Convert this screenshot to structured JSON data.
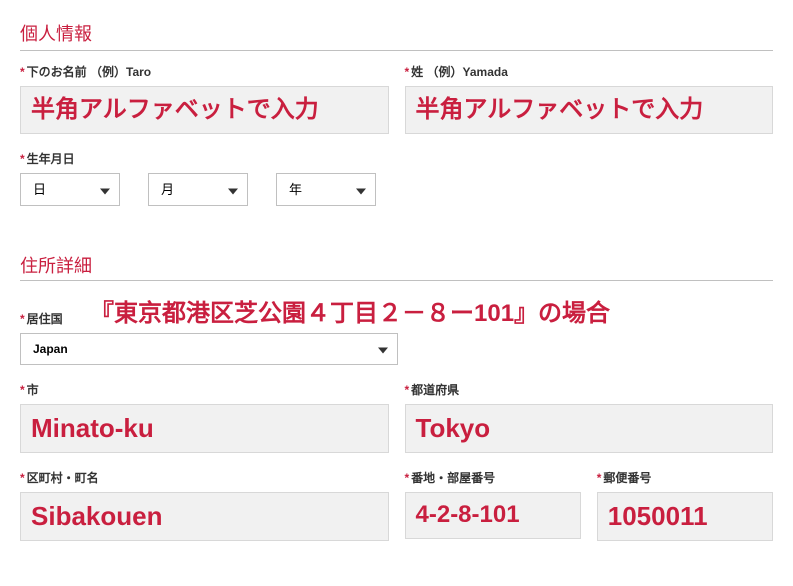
{
  "colors": {
    "accent": "#c91f3f",
    "input_bg": "#f1f1f1",
    "border": "#d8d8d8"
  },
  "personal": {
    "section_title": "個人情報",
    "first_name": {
      "label": "下のお名前 （例）Taro",
      "example": "半角アルファベットで入力"
    },
    "last_name": {
      "label": "姓 （例）Yamada",
      "example": "半角アルファベットで入力"
    },
    "dob": {
      "label": "生年月日",
      "day": "日",
      "month": "月",
      "year": "年"
    }
  },
  "address": {
    "section_title": "住所詳細",
    "annotation": "『東京都港区芝公園４丁目２－８ー101』の場合",
    "country": {
      "label": "居住国",
      "selected": "Japan"
    },
    "city": {
      "label": "市",
      "example": "Minato-ku"
    },
    "prefecture": {
      "label": "都道府県",
      "example": "Tokyo"
    },
    "ward_town": {
      "label": "区町村・町名",
      "example": "Sibakouen"
    },
    "street_room": {
      "label": "番地・部屋番号",
      "example": "4-2-8-101"
    },
    "postal": {
      "label": "郵便番号",
      "example": "1050011"
    }
  }
}
